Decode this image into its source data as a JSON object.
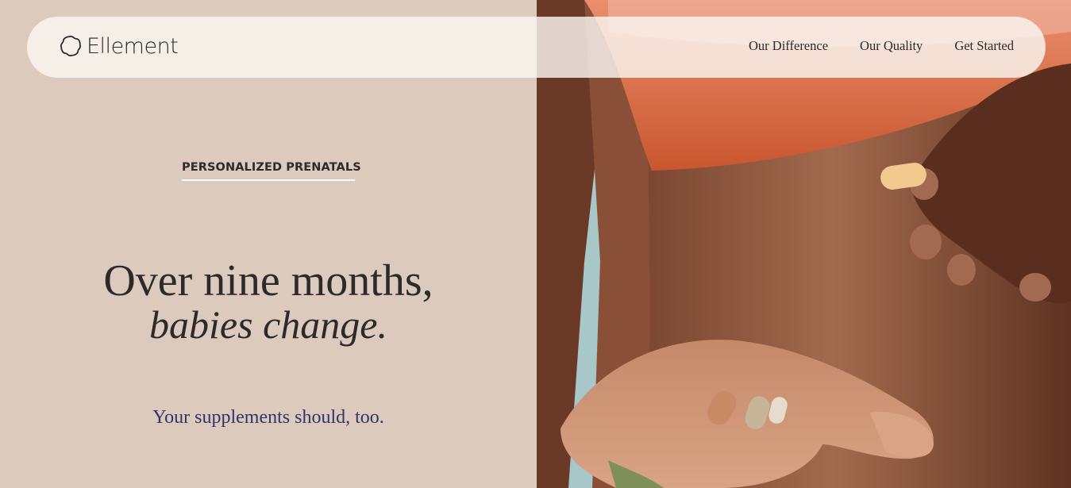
{
  "brand": {
    "name": "Ellement",
    "logo_icon": "flower-outline-icon"
  },
  "nav": {
    "links": [
      {
        "label": "Our Difference"
      },
      {
        "label": "Our Quality"
      },
      {
        "label": "Get Started"
      }
    ]
  },
  "hero": {
    "eyebrow": "PERSONALIZED PRENATALS",
    "headline_line1": "Over nine months,",
    "headline_line2": "babies change.",
    "subheadline": "Your supplements should, too."
  },
  "colors": {
    "background": "#dccabd",
    "text": "#2b2b2b",
    "subhead": "#2f3566",
    "nav_bar": "#faf6f2",
    "photo_backdrop": "#a7c7c9",
    "shirt": "#d4663b"
  }
}
